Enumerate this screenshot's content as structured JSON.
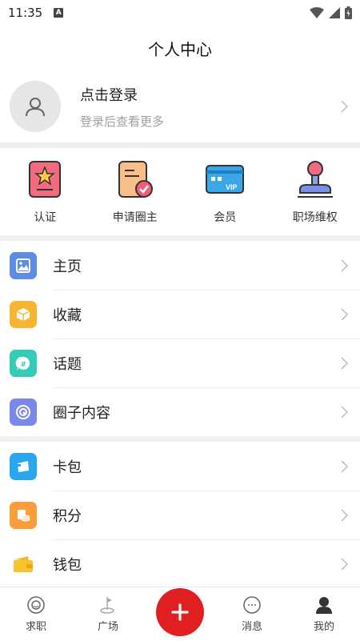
{
  "status": {
    "time": "11:35",
    "badge": "A"
  },
  "title": "个人中心",
  "login": {
    "title": "点击登录",
    "subtitle": "登录后查看更多"
  },
  "grid": [
    {
      "label": "认证",
      "icon": "certificate-icon"
    },
    {
      "label": "申请圈主",
      "icon": "apply-owner-icon"
    },
    {
      "label": "会员",
      "icon": "vip-card-icon"
    },
    {
      "label": "职场维权",
      "icon": "stamp-icon"
    }
  ],
  "menu1": [
    {
      "label": "主页",
      "icon": "image-icon",
      "color": "#5c8de6"
    },
    {
      "label": "收藏",
      "icon": "box-icon",
      "color": "#f7b534"
    },
    {
      "label": "话题",
      "icon": "hash-icon",
      "color": "#35cbb9"
    },
    {
      "label": "圈子内容",
      "icon": "circle-icon",
      "color": "#7a88e8"
    }
  ],
  "menu2": [
    {
      "label": "卡包",
      "icon": "card-icon",
      "color": "#2aa6f0"
    },
    {
      "label": "积分",
      "icon": "coins-icon",
      "color": "#fa9d3a"
    },
    {
      "label": "钱包",
      "icon": "wallet-icon",
      "color": "#f7c32e"
    }
  ],
  "tabs": [
    {
      "label": "求职",
      "icon": "smile-icon"
    },
    {
      "label": "广场",
      "icon": "flag-icon"
    },
    {
      "label": "",
      "icon": "plus-icon"
    },
    {
      "label": "消息",
      "icon": "message-icon"
    },
    {
      "label": "我的",
      "icon": "person-icon"
    }
  ],
  "colors": {
    "accent": "#e02020",
    "divider": "#f0f0f0"
  }
}
